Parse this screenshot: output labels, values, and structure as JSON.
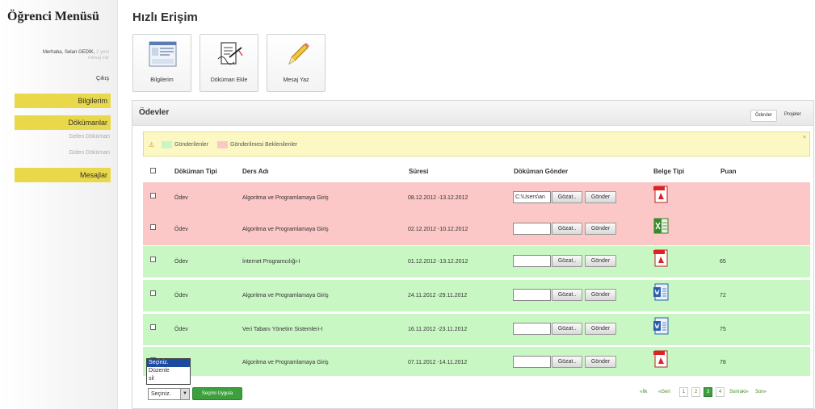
{
  "sidebar": {
    "title": "Öğrenci Menüsü",
    "greeting": "Merhaba, Selan GEDİK,",
    "greeting_extra": "2 yeni",
    "greeting_extra2": "mesaj var",
    "logout": "Çıkış",
    "menu": {
      "profile": "Bilgilerim",
      "documents": "Dökümanlar",
      "incoming": "Gelen Döküman",
      "outgoing": "Giden Döküman",
      "messages": "Mesajlar"
    }
  },
  "main": {
    "title": "Hızlı Erişim",
    "quick_access": [
      {
        "label": "Bilgilerim",
        "icon": "profile-screenshot-icon"
      },
      {
        "label": "Döküman Ekle",
        "icon": "add-document-icon"
      },
      {
        "label": "Mesaj Yaz",
        "icon": "pencil-icon"
      }
    ]
  },
  "panel": {
    "title": "Ödevler",
    "tabs": [
      "Ödevler",
      "Projeler"
    ],
    "legend": {
      "sent": "Gönderilenler",
      "pending": "Gönderilmesi Beklenilenler",
      "sent_color": "#c9f7c4",
      "pending_color": "#fbc7c7",
      "close": "×"
    },
    "columns": [
      "Döküman Tipi",
      "Ders Adı",
      "Süresi",
      "Döküman Gönder",
      "Belge Tipi",
      "Puan"
    ],
    "rows": [
      {
        "type": "Ödev",
        "course": "Algoritma ve Programlamaya Giriş",
        "period": "08.12.2012 -13.12.2012",
        "file": "C:\\Users\\an",
        "doc": "pdf",
        "score": "",
        "status": "pending"
      },
      {
        "type": "Ödev",
        "course": "Algoritma ve Programlamaya Giriş",
        "period": "02.12.2012 -10.12.2012",
        "file": "",
        "doc": "excel",
        "score": "",
        "status": "pending"
      },
      {
        "type": "Ödev",
        "course": "İnternet Programcılığı-I",
        "period": "01.12.2012 -13.12.2012",
        "file": "",
        "doc": "pdf",
        "score": "65",
        "status": "sent"
      },
      {
        "type": "Ödev",
        "course": "Algoritma ve Programlamaya Giriş",
        "period": "24.11.2012 -29.11.2012",
        "file": "",
        "doc": "word",
        "score": "72",
        "status": "sent"
      },
      {
        "type": "Ödev",
        "course": "Veri Tabanı Yönetim Sistemleri-I",
        "period": "16.11.2012 -23.11.2012",
        "file": "",
        "doc": "word",
        "score": "75",
        "status": "sent"
      },
      {
        "type": "Ödev",
        "course": "Algoritma ve Programlamaya Giriş",
        "period": "07.11.2012 -14.11.2012",
        "file": "",
        "doc": "pdf",
        "score": "78",
        "status": "sent"
      }
    ],
    "browse_label": "Gözat..",
    "send_label": "Gönder",
    "bulk": {
      "selected": "Seçiniz.",
      "options": [
        "Seçiniz.",
        "Düzenle",
        "sil"
      ],
      "apply": "Seçimi Uygula"
    },
    "pagination": {
      "first": "«İlk",
      "prev": "«Geri",
      "pages": [
        "1",
        "2",
        "3",
        "4"
      ],
      "current": "3",
      "next": "Sonraki»",
      "last": "Son»"
    }
  }
}
